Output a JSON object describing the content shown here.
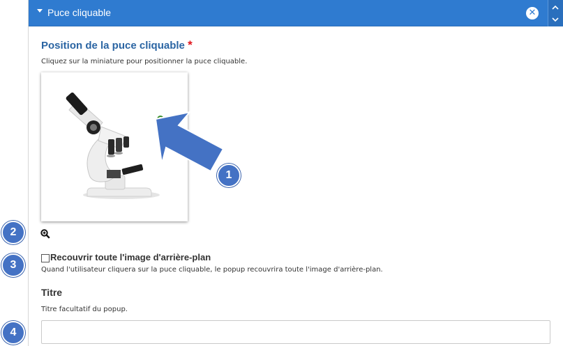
{
  "panel": {
    "title": "Puce cliquable",
    "remove_icon": "close-circle-icon",
    "colors": {
      "header": "#2f7bd0",
      "label": "#2b65a3",
      "required": "#e0141b",
      "callout": "#4472c4"
    }
  },
  "position_field": {
    "label": "Position de la puce cliquable",
    "required_mark": "*",
    "description": "Cliquez sur la miniature pour positionner la puce cliquable.",
    "zoom_icon": "zoom-in-icon"
  },
  "cover_field": {
    "label": "Recouvrir toute l'image d'arrière-plan",
    "checked": false,
    "description": "Quand l'utilisateur cliquera sur la puce cliquable, le popup recouvrira toute l'image d'arrière-plan."
  },
  "title_field": {
    "label": "Titre",
    "description": "Titre facultatif du popup.",
    "value": ""
  },
  "callouts": [
    "1",
    "2",
    "3",
    "4"
  ]
}
